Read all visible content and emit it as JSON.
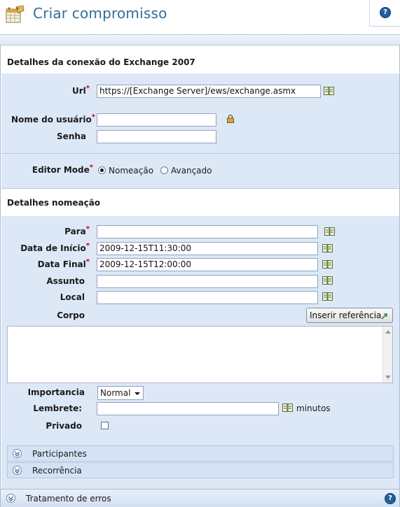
{
  "header": {
    "title": "Criar compromisso",
    "help_icon": "?"
  },
  "exchange": {
    "section_title": "Detalhes da conexão do Exchange 2007",
    "url_label": "Url",
    "url_value": "https://[Exchange Server]/ews/exchange.asmx",
    "username_label": "Nome do usuário",
    "username_value": "",
    "password_label": "Senha",
    "password_value": "",
    "editor_mode_label": "Editor Mode",
    "editor_modes": [
      {
        "label": "Nomeação",
        "selected": true
      },
      {
        "label": "Avançado",
        "selected": false
      }
    ]
  },
  "appointment": {
    "section_title": "Detalhes nomeação",
    "to_label": "Para",
    "to_value": "",
    "start_label": "Data de Início",
    "start_value": "2009-12-15T11:30:00",
    "end_label": "Data Final",
    "end_value": "2009-12-15T12:00:00",
    "subject_label": "Assunto",
    "subject_value": "",
    "location_label": "Local",
    "location_value": "",
    "body_label": "Corpo",
    "insert_reference_label": "Inserir referência",
    "body_value": "",
    "importance_label": "Importancia",
    "importance_value": "Normal",
    "reminder_label": "Lembrete:",
    "reminder_value": "",
    "reminder_unit": "minutos",
    "private_label": "Privado",
    "private_checked": false
  },
  "collapsibles": [
    {
      "label": "Participantes"
    },
    {
      "label": "Recorrência"
    }
  ],
  "error_handling": {
    "label": "Tratamento de erros"
  },
  "required_marker": "*",
  "colors": {
    "title": "#2f6f96",
    "panel_bg": "#dde8f7",
    "required": "#cc0000"
  }
}
